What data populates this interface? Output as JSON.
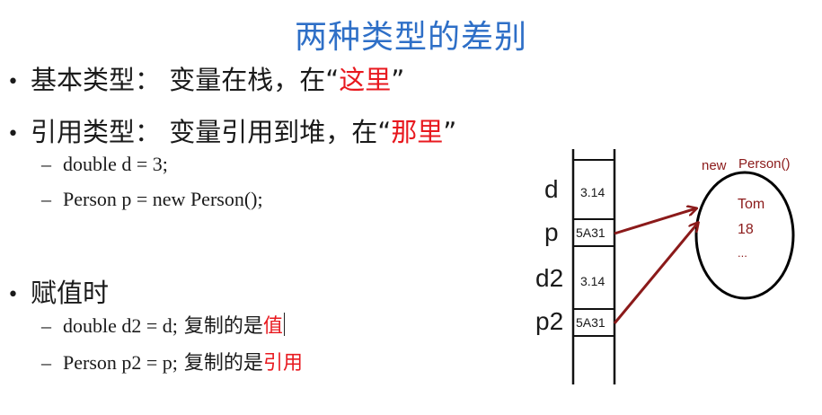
{
  "title": "两种类型的差别",
  "bullets": [
    {
      "text": "基本类型： 变量在栈，在“",
      "highlight": "这里",
      "tail": "”"
    },
    {
      "text": "引用类型： 变量引用到堆，在“",
      "highlight": "那里",
      "tail": "”"
    },
    {
      "text": "赋值时"
    }
  ],
  "sub_items": {
    "ref_1": "double  d = 3;",
    "ref_2": "Person p = new Person();",
    "assign_1_code": "double d2 = d;",
    "assign_1_text": "复制的是",
    "assign_1_highlight": "值",
    "assign_2_code": "Person p2 = p;",
    "assign_2_text": "复制的是",
    "assign_2_highlight": "引用"
  },
  "diagram": {
    "stack": [
      {
        "name": "d",
        "value": "3.14"
      },
      {
        "name": "p",
        "value": "5A31"
      },
      {
        "name": "d2",
        "value": "3.14"
      },
      {
        "name": "p2",
        "value": "5A31"
      }
    ],
    "heap": {
      "label_new": "new",
      "label_class": "Person()",
      "fields": [
        "Tom",
        "18",
        "..."
      ]
    },
    "colors": {
      "arrow": "#8b1a1a",
      "title": "#2e6fc7",
      "highlight": "#e8191f"
    }
  }
}
